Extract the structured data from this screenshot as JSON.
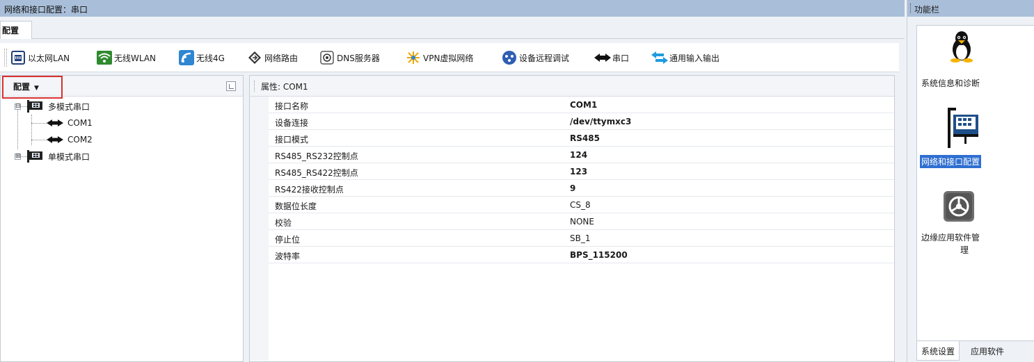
{
  "window": {
    "title": "网络和接口配置：串口"
  },
  "tabs": [
    {
      "label": "配置"
    }
  ],
  "toolbar": {
    "items": [
      {
        "label": "以太网LAN",
        "icon": "ethernet-icon"
      },
      {
        "label": "无线WLAN",
        "icon": "wifi-icon"
      },
      {
        "label": "无线4G",
        "icon": "cellular-4g-icon"
      },
      {
        "label": "网络路由",
        "icon": "router-icon"
      },
      {
        "label": "DNS服务器",
        "icon": "dns-server-icon"
      },
      {
        "label": "VPN虚拟网络",
        "icon": "vpn-icon"
      },
      {
        "label": "设备远程调试",
        "icon": "remote-debug-icon"
      },
      {
        "label": "串口",
        "icon": "serial-port-icon"
      },
      {
        "label": "通用输入输出",
        "icon": "gpio-icon"
      }
    ]
  },
  "left_panel": {
    "dropdown_label": "配置",
    "tree": {
      "groups": [
        {
          "label": "多模式串口",
          "expander": "⊟",
          "children": [
            {
              "label": "COM1"
            },
            {
              "label": "COM2"
            }
          ]
        },
        {
          "label": "单模式串口",
          "expander": "⊞",
          "children": []
        }
      ]
    }
  },
  "properties": {
    "header": "属性: COM1",
    "rows": [
      {
        "key": "接口名称",
        "value": "COM1",
        "bold": true
      },
      {
        "key": "设备连接",
        "value": "/dev/ttymxc3",
        "bold": true
      },
      {
        "key": "接口模式",
        "value": "RS485",
        "bold": true
      },
      {
        "key": "RS485_RS232控制点",
        "value": "124",
        "bold": true
      },
      {
        "key": "RS485_RS422控制点",
        "value": "123",
        "bold": true
      },
      {
        "key": "RS422接收控制点",
        "value": "9",
        "bold": true
      },
      {
        "key": "数据位长度",
        "value": "CS_8",
        "bold": false
      },
      {
        "key": "校验",
        "value": "NONE",
        "bold": false
      },
      {
        "key": "停止位",
        "value": "SB_1",
        "bold": false
      },
      {
        "key": "波特率",
        "value": "BPS_115200",
        "bold": true
      }
    ]
  },
  "side_bar": {
    "title": "功能栏",
    "items": [
      {
        "label": "系统信息和诊断",
        "icon": "linux-penguin-icon",
        "selected": false
      },
      {
        "label": "网络和接口配置",
        "icon": "network-card-icon",
        "selected": true
      },
      {
        "label": "边缘应用软件管",
        "label2": "理",
        "icon": "settings-gear-icon",
        "selected": false
      }
    ],
    "tabs": [
      {
        "label": "系统设置",
        "active": true
      },
      {
        "label": "应用软件",
        "active": false
      }
    ]
  },
  "colors": {
    "title_bar": "#a9bfd9",
    "selection": "#2f6fd1",
    "highlight_border": "#d93030"
  }
}
